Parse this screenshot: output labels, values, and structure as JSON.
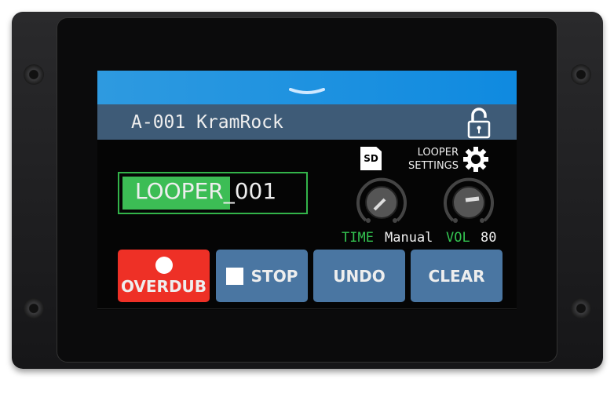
{
  "header": {
    "patch_title": "A-001 KramRock",
    "lock_icon": "unlocked-padlock-icon",
    "collapse_icon": "chevron-down-icon"
  },
  "storage": {
    "sd_label": "SD"
  },
  "settings": {
    "label_line1": "LOOPER",
    "label_line2": "SETTINGS",
    "icon": "gear-icon"
  },
  "file": {
    "name_selected": "LOOPER",
    "name_rest": "_001"
  },
  "knobs": [
    {
      "label": "TIME",
      "value": "Manual"
    },
    {
      "label": "VOL",
      "value": "80"
    }
  ],
  "buttons": {
    "overdub": "OVERDUB",
    "stop": "STOP",
    "undo": "UNDO",
    "clear": "CLEAR"
  },
  "colors": {
    "accent_green": "#3cbd55",
    "record_red": "#ee3026",
    "button_blue": "#4a76a2",
    "top_bar_blue": "#1e90dc"
  }
}
